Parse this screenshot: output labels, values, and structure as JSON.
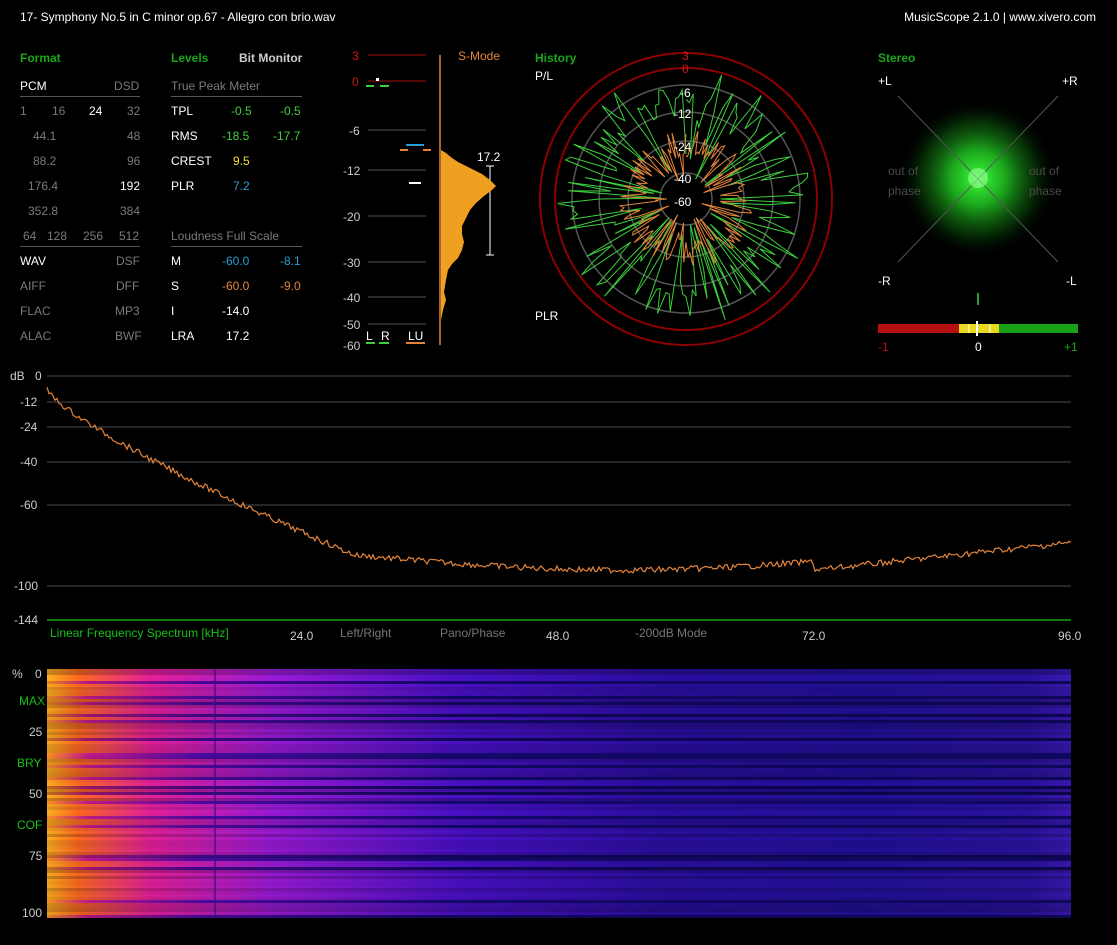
{
  "title": "17- Symphony No.5 in C minor op.67 - Allegro con brio.wav",
  "app_credit": "MusicScope 2.1.0 | www.xivero.com",
  "format": {
    "heading": "Format",
    "pcm": "PCM",
    "dsd": "DSD",
    "bits": [
      "1",
      "16",
      "24",
      "32"
    ],
    "rates_pcm": [
      "44.1",
      "88.2",
      "176.4",
      "352.8"
    ],
    "rates_dsd": [
      "48",
      "96",
      "192",
      "384"
    ],
    "dsd_mult": [
      "64",
      "128",
      "256",
      "512"
    ],
    "types_left": [
      "WAV",
      "AIFF",
      "FLAC",
      "ALAC"
    ],
    "types_right": [
      "DSF",
      "DFF",
      "MP3",
      "BWF"
    ]
  },
  "levels": {
    "heading": "Levels",
    "bit_monitor": "Bit Monitor",
    "true_peak_meter": "True Peak Meter",
    "rows": [
      {
        "label": "TPL",
        "l": "-0.5",
        "r": "-0.5"
      },
      {
        "label": "RMS",
        "l": "-18.5",
        "r": "-17.7"
      },
      {
        "label": "CREST",
        "l": "9.5",
        "r": ""
      },
      {
        "label": "PLR",
        "l": "7.2",
        "r": ""
      }
    ],
    "loudness_heading": "Loudness Full Scale",
    "loud_rows": [
      {
        "label": "M",
        "l": "-60.0",
        "r": "-8.1"
      },
      {
        "label": "S",
        "l": "-60.0",
        "r": "-9.0"
      },
      {
        "label": "I",
        "l": "-14.0",
        "r": ""
      },
      {
        "label": "LRA",
        "l": "17.2",
        "r": ""
      }
    ]
  },
  "meter": {
    "smode": "S-Mode",
    "scale": [
      "3",
      "0",
      "-6",
      "-12",
      "-20",
      "-30",
      "-40",
      "-50",
      "-60"
    ],
    "lra_label": "17.2",
    "channels": [
      "L",
      "R",
      "LU"
    ]
  },
  "history": {
    "heading": "History",
    "pl": "P/L",
    "plr": "PLR",
    "rings": [
      "3",
      "0",
      "-6",
      "-12",
      "-24",
      "-40",
      "-60"
    ]
  },
  "stereo": {
    "heading": "Stereo",
    "corners": {
      "tl": "+L",
      "tr": "+R",
      "bl": "-R",
      "br": "-L"
    },
    "out_of_phase": [
      "out of",
      "phase"
    ],
    "correlation": [
      "-1",
      "0",
      "+1"
    ]
  },
  "spectrum": {
    "db_label": "dB",
    "y_ticks": [
      "0",
      "-12",
      "-24",
      "-40",
      "-60",
      "-100",
      "-144"
    ],
    "x_ticks": [
      "24.0",
      "48.0",
      "72.0",
      "96.0"
    ],
    "mode_label": "Linear Frequency Spectrum [kHz]",
    "modes": [
      "Left/Right",
      "Pano/Phase",
      "-200dB Mode"
    ]
  },
  "spectrogram": {
    "pct_label": "%",
    "y_ticks": [
      "0",
      "25",
      "50",
      "75",
      "100"
    ],
    "markers": [
      "MAX",
      "BRY",
      "COF"
    ]
  },
  "colors": {
    "accent": "#19a619",
    "left": "#2a9dd8",
    "right": "#e3843a",
    "ring": "#8b0000"
  }
}
